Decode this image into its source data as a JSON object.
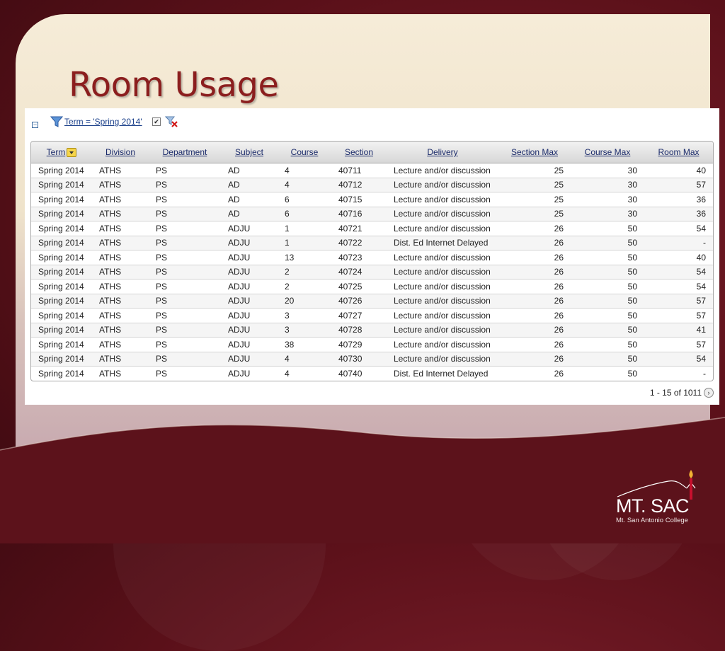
{
  "slide": {
    "title": "Room Usage"
  },
  "filter": {
    "label": "Term = 'Spring 2014'",
    "checked": true
  },
  "table": {
    "columns": [
      "Term",
      "Division",
      "Department",
      "Subject",
      "Course",
      "Section",
      "Delivery",
      "Section Max",
      "Course Max",
      "Room Max"
    ],
    "rows": [
      [
        "Spring 2014",
        "ATHS",
        "PS",
        "AD",
        "4",
        "40711",
        "Lecture and/or discussion",
        "25",
        "30",
        "40"
      ],
      [
        "Spring 2014",
        "ATHS",
        "PS",
        "AD",
        "4",
        "40712",
        "Lecture and/or discussion",
        "25",
        "30",
        "57"
      ],
      [
        "Spring 2014",
        "ATHS",
        "PS",
        "AD",
        "6",
        "40715",
        "Lecture and/or discussion",
        "25",
        "30",
        "36"
      ],
      [
        "Spring 2014",
        "ATHS",
        "PS",
        "AD",
        "6",
        "40716",
        "Lecture and/or discussion",
        "25",
        "30",
        "36"
      ],
      [
        "Spring 2014",
        "ATHS",
        "PS",
        "ADJU",
        "1",
        "40721",
        "Lecture and/or discussion",
        "26",
        "50",
        "54"
      ],
      [
        "Spring 2014",
        "ATHS",
        "PS",
        "ADJU",
        "1",
        "40722",
        "Dist. Ed Internet Delayed",
        "26",
        "50",
        "-"
      ],
      [
        "Spring 2014",
        "ATHS",
        "PS",
        "ADJU",
        "13",
        "40723",
        "Lecture and/or discussion",
        "26",
        "50",
        "40"
      ],
      [
        "Spring 2014",
        "ATHS",
        "PS",
        "ADJU",
        "2",
        "40724",
        "Lecture and/or discussion",
        "26",
        "50",
        "54"
      ],
      [
        "Spring 2014",
        "ATHS",
        "PS",
        "ADJU",
        "2",
        "40725",
        "Lecture and/or discussion",
        "26",
        "50",
        "54"
      ],
      [
        "Spring 2014",
        "ATHS",
        "PS",
        "ADJU",
        "20",
        "40726",
        "Lecture and/or discussion",
        "26",
        "50",
        "57"
      ],
      [
        "Spring 2014",
        "ATHS",
        "PS",
        "ADJU",
        "3",
        "40727",
        "Lecture and/or discussion",
        "26",
        "50",
        "57"
      ],
      [
        "Spring 2014",
        "ATHS",
        "PS",
        "ADJU",
        "3",
        "40728",
        "Lecture and/or discussion",
        "26",
        "50",
        "41"
      ],
      [
        "Spring 2014",
        "ATHS",
        "PS",
        "ADJU",
        "38",
        "40729",
        "Lecture and/or discussion",
        "26",
        "50",
        "57"
      ],
      [
        "Spring 2014",
        "ATHS",
        "PS",
        "ADJU",
        "4",
        "40730",
        "Lecture and/or discussion",
        "26",
        "50",
        "54"
      ],
      [
        "Spring 2014",
        "ATHS",
        "PS",
        "ADJU",
        "4",
        "40740",
        "Dist. Ed Internet Delayed",
        "26",
        "50",
        "-"
      ]
    ]
  },
  "pagination": {
    "range": "1 - 15 of 1011"
  },
  "logo": {
    "name": "MT. SAC",
    "subtitle": "Mt. San Antonio College"
  },
  "colors": {
    "title": "#8b1e1e",
    "background": "#5a1019",
    "panel": "#f6ecd8",
    "link": "#1a3f8a"
  },
  "icons": [
    "collapse-icon",
    "filter-funnel-icon",
    "remove-filter-icon",
    "sort-dropdown-icon",
    "next-page-icon"
  ]
}
